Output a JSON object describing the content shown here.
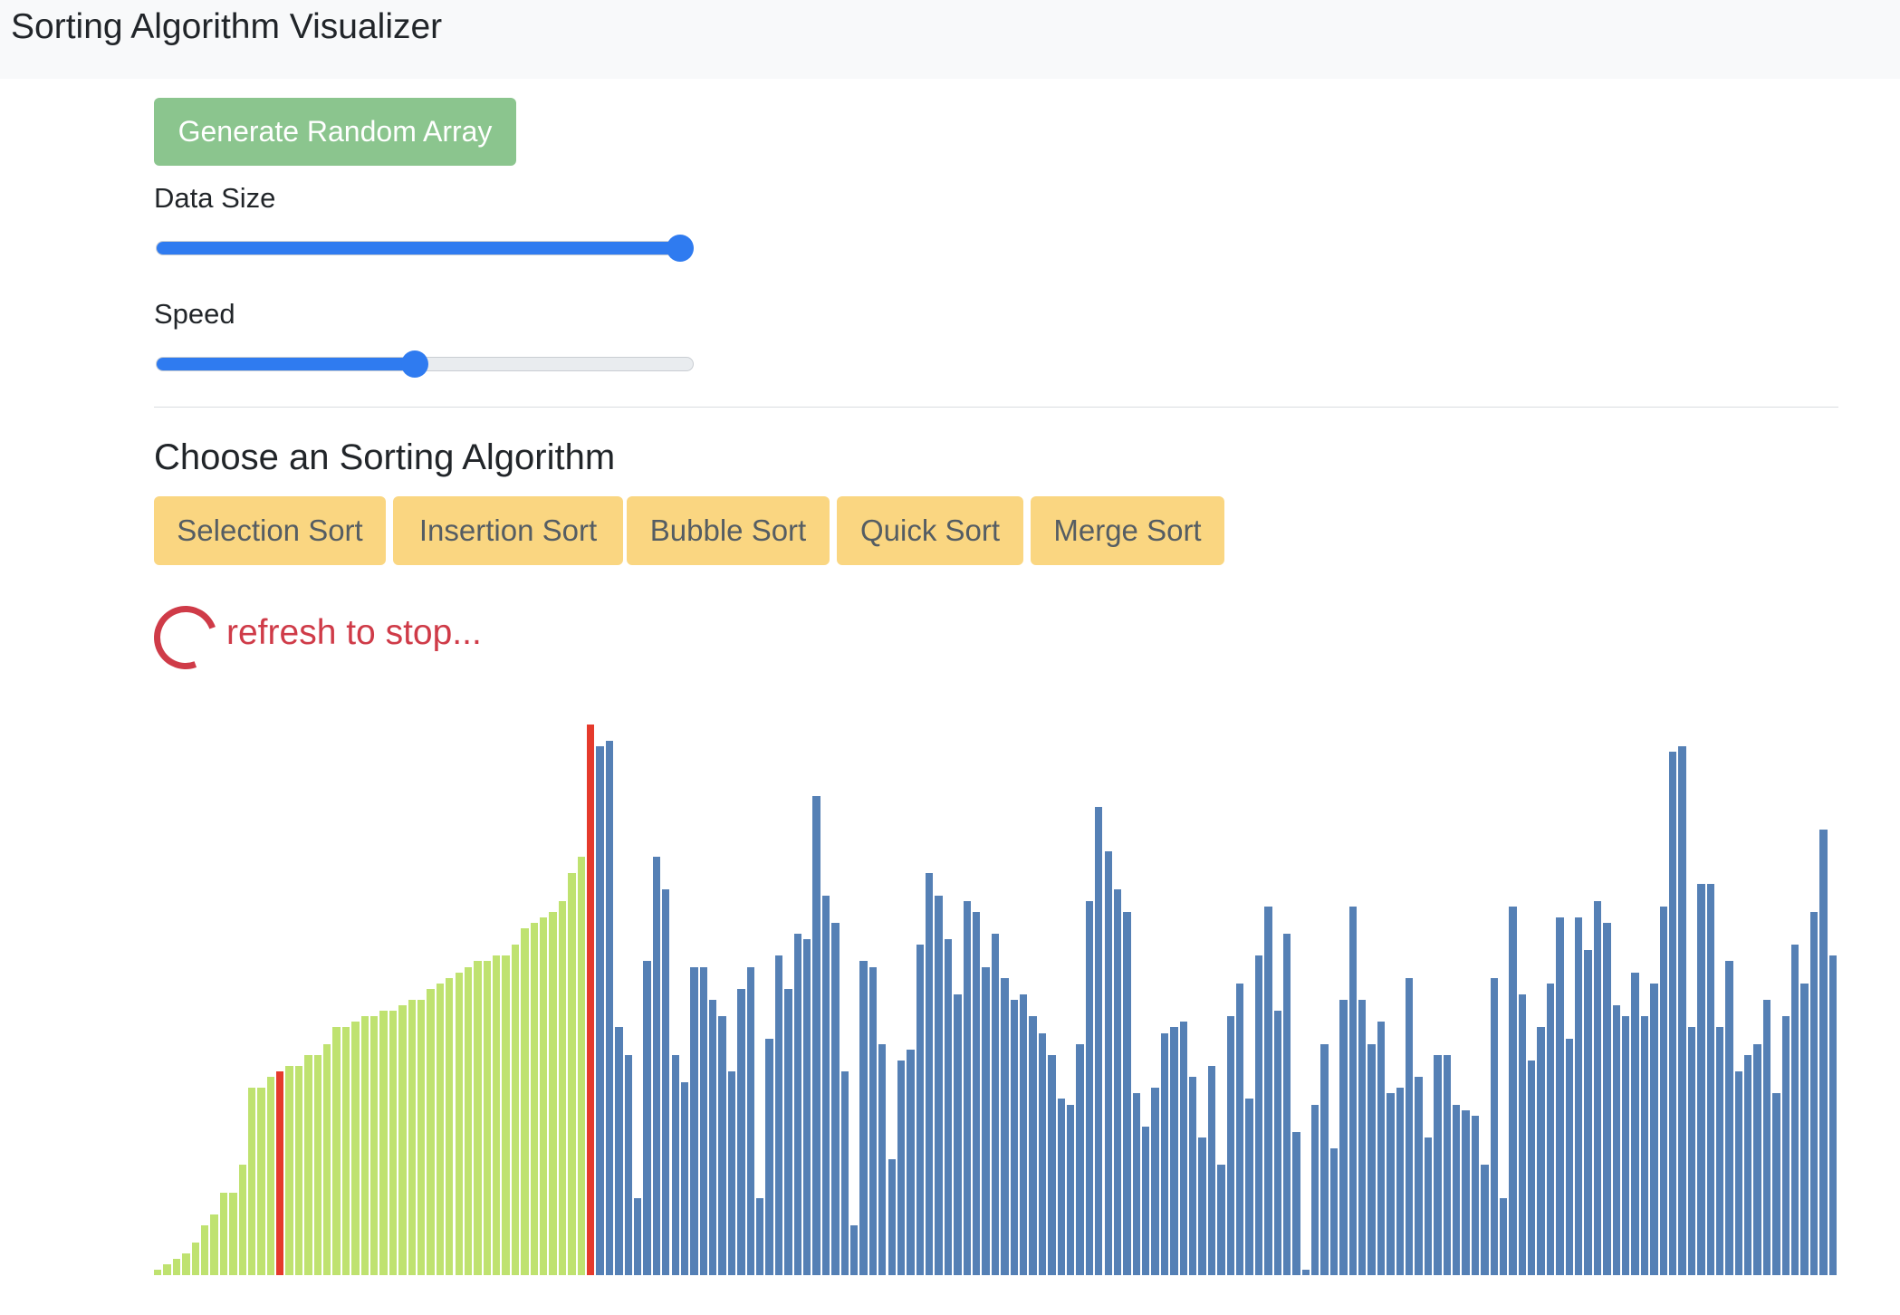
{
  "navbar": {
    "brand": "Sorting Algorithm Visualizer"
  },
  "controls": {
    "generate_label": "Generate Random Array",
    "data_size": {
      "label": "Data Size",
      "value_fraction": 1.0
    },
    "speed": {
      "label": "Speed",
      "value_fraction": 0.48
    }
  },
  "algorithms": {
    "title": "Choose an Sorting Algorithm",
    "buttons": [
      "Selection Sort",
      "Insertion Sort",
      "Bubble Sort",
      "Quick Sort",
      "Merge Sort"
    ]
  },
  "status": {
    "text": "refresh to stop..."
  },
  "colors": {
    "accent": "#2f7bf0",
    "generate_button": "#8bc58e",
    "algo_button": "#fad681",
    "status": "#cf3b48",
    "sorted_bar": "#bfe270",
    "compare_bar": "#e53a2c",
    "unsorted_bar": "#5580b5"
  },
  "array": {
    "max_value": 100,
    "sorted_count": 46,
    "highlight_indices": [
      13,
      46
    ],
    "values": [
      1,
      2,
      3,
      4,
      6,
      9,
      11,
      15,
      15,
      20,
      34,
      34,
      36,
      37,
      38,
      38,
      40,
      40,
      42,
      45,
      45,
      46,
      47,
      47,
      48,
      48,
      49,
      50,
      50,
      52,
      53,
      54,
      55,
      56,
      57,
      57,
      58,
      58,
      60,
      63,
      64,
      65,
      66,
      68,
      73,
      76,
      100,
      96,
      97,
      45,
      40,
      14,
      57,
      76,
      70,
      40,
      35,
      56,
      56,
      50,
      47,
      37,
      52,
      56,
      14,
      43,
      58,
      52,
      62,
      61,
      87,
      69,
      64,
      37,
      9,
      57,
      56,
      42,
      21,
      39,
      41,
      60,
      73,
      69,
      61,
      51,
      68,
      66,
      56,
      62,
      54,
      50,
      51,
      47,
      44,
      40,
      32,
      31,
      42,
      68,
      85,
      77,
      70,
      66,
      33,
      27,
      34,
      44,
      45,
      46,
      36,
      25,
      38,
      20,
      47,
      53,
      32,
      58,
      67,
      48,
      62,
      26,
      1,
      31,
      42,
      23,
      50,
      67,
      50,
      42,
      46,
      33,
      34,
      54,
      36,
      25,
      40,
      40,
      31,
      30,
      29,
      20,
      54,
      14,
      67,
      51,
      39,
      45,
      53,
      65,
      43,
      65,
      59,
      68,
      64,
      49,
      47,
      55,
      47,
      53,
      67,
      95,
      96,
      45,
      71,
      71,
      45,
      57,
      37,
      40,
      42,
      50,
      33,
      47,
      60,
      53,
      66,
      81,
      58
    ]
  }
}
